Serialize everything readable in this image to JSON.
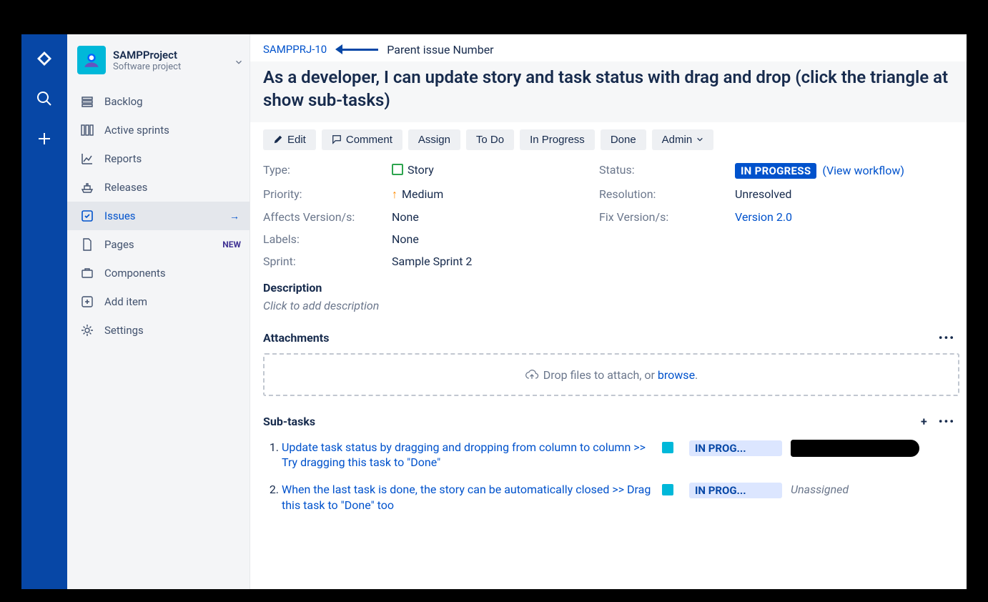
{
  "project": {
    "name": "SAMPProject",
    "subtitle": "Software project"
  },
  "sidebar": {
    "items": [
      {
        "label": "Backlog"
      },
      {
        "label": "Active sprints"
      },
      {
        "label": "Reports"
      },
      {
        "label": "Releases"
      },
      {
        "label": "Issues"
      },
      {
        "label": "Pages",
        "badge": "NEW"
      },
      {
        "label": "Components"
      },
      {
        "label": "Add item"
      },
      {
        "label": "Settings"
      }
    ]
  },
  "breadcrumb": {
    "issue_key": "SAMPPRJ-10",
    "annotation": "Parent issue Number"
  },
  "issue": {
    "summary": "As a developer, I can update story and task status with drag and drop (click the triangle at show sub-tasks)"
  },
  "toolbar": {
    "edit": "Edit",
    "comment": "Comment",
    "assign": "Assign",
    "todo": "To Do",
    "in_progress": "In Progress",
    "done": "Done",
    "admin": "Admin"
  },
  "fields": {
    "type_label": "Type:",
    "type_value": "Story",
    "priority_label": "Priority:",
    "priority_value": "Medium",
    "affects_label": "Affects Version/s:",
    "affects_value": "None",
    "labels_label": "Labels:",
    "labels_value": "None",
    "sprint_label": "Sprint:",
    "sprint_value": "Sample Sprint 2",
    "status_label": "Status:",
    "status_value": "IN PROGRESS",
    "view_workflow": "(View workflow)",
    "resolution_label": "Resolution:",
    "resolution_value": "Unresolved",
    "fixv_label": "Fix Version/s:",
    "fixv_value": "Version 2.0"
  },
  "description": {
    "heading": "Description",
    "placeholder": "Click to add description"
  },
  "attachments": {
    "heading": "Attachments",
    "drop_text": "Drop files to attach, or ",
    "browse": "browse",
    "dot": "."
  },
  "subtasks": {
    "heading": "Sub-tasks",
    "items": [
      {
        "title": "Update task status by dragging and dropping from column to column >> Try dragging this task to \"Done\"",
        "status": "IN PROG...",
        "assignee": ""
      },
      {
        "title": "When the last task is done, the story can be automatically closed >> Drag this task to \"Done\" too",
        "status": "IN PROG...",
        "assignee": "Unassigned"
      }
    ]
  }
}
